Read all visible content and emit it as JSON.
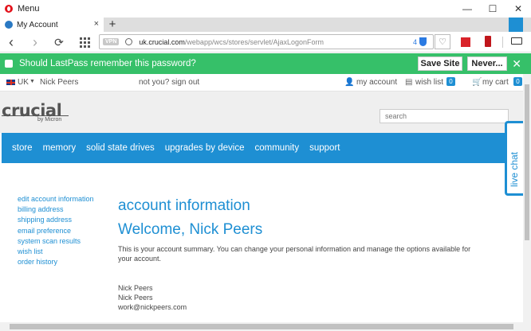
{
  "window": {
    "menu_label": "Menu",
    "minimize": "—",
    "maximize": "☐",
    "close": "✕"
  },
  "tab": {
    "title": "My Account",
    "close": "×",
    "new": "+"
  },
  "nav": {
    "back": "‹",
    "forward": "›",
    "reload": "⟳",
    "vpn": "VPN",
    "url_domain": "uk.crucial.com",
    "url_path": "/webapp/wcs/stores/servlet/AjaxLogonForm",
    "blocked_count": "4",
    "heart": "♡"
  },
  "lastpass": {
    "message": "Should LastPass remember this password?",
    "save_label": "Save Site",
    "never_label": "Never...",
    "close": "✕"
  },
  "site_top": {
    "region": "UK",
    "user": "Nick Peers",
    "not_you": "not you? sign out",
    "my_account": "my account",
    "wish_list": "wish list",
    "wish_count": "0",
    "my_cart": "my cart",
    "cart_count": "0"
  },
  "header": {
    "logo": "crucial",
    "logo_sub": "by Micron",
    "search_placeholder": "search"
  },
  "main_nav": [
    "store",
    "memory",
    "solid state drives",
    "upgrades by device",
    "community",
    "support"
  ],
  "live_chat": "live chat",
  "sidenav": [
    "edit account information",
    "billing address",
    "shipping address",
    "email preference",
    "system scan results",
    "wish list",
    "order history"
  ],
  "content": {
    "heading": "account information",
    "welcome": "Welcome, Nick Peers",
    "summary": "This is your account summary. You can change your personal information and manage the options available for your account.",
    "address_lines": [
      "Nick Peers",
      "Nick Peers",
      "work@nickpeers.com"
    ]
  }
}
